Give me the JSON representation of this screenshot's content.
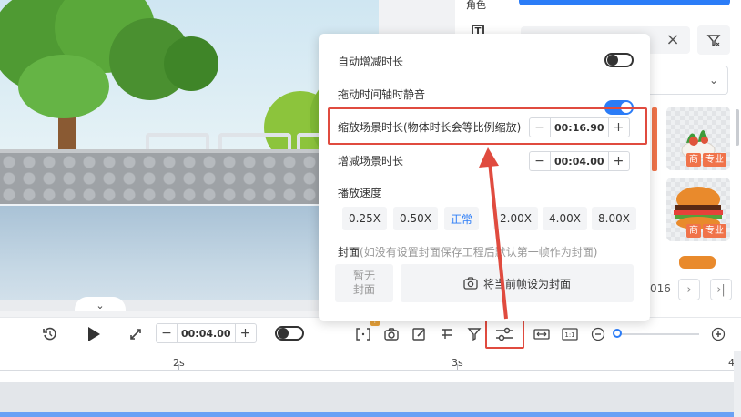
{
  "toolstrip": {
    "label_top": "角色",
    "text_tool_icon": "T"
  },
  "popup": {
    "auto_duration_label": "自动增减时长",
    "drag_mute_label": "拖动时间轴时静音",
    "scale_scene_label": "缩放场景时长(物体时长会等比例缩放)",
    "scale_scene_value": "00:16.90",
    "adjust_scene_label": "增减场景时长",
    "adjust_scene_value": "00:04.00",
    "speed_label": "播放速度",
    "speeds": [
      "0.25X",
      "0.50X",
      "正常",
      "2.00X",
      "4.00X",
      "8.00X"
    ],
    "active_speed": "正常",
    "cover_label": "封面",
    "cover_hint": "(如没有设置封面保存工程后默认第一帧作为封面)",
    "no_cover_line1": "暂无",
    "no_cover_line2": "封面",
    "set_cover_label": "将当前帧设为封面",
    "auto_duration_on": false,
    "drag_mute_on": true
  },
  "rightpanel": {
    "badge_shop": "商",
    "badge_pro": "专业",
    "pager_text": "016"
  },
  "controlbar": {
    "duration_value": "00:04.00",
    "scene_badge": "?"
  },
  "timeline": {
    "ticks": [
      "2s",
      "3s",
      "4"
    ]
  },
  "colors": {
    "accent": "#2b7cf7",
    "annotation": "#e04b3f",
    "badge": "#f0734a"
  }
}
